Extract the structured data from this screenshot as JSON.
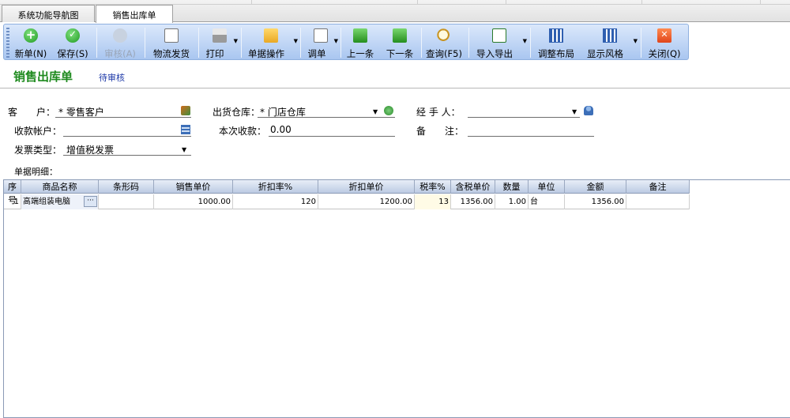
{
  "tabs": [
    {
      "label": "系统功能导航图"
    },
    {
      "label": "销售出库单"
    }
  ],
  "toolbar": {
    "buttons": [
      {
        "label": "新单(N)",
        "icon": "plus-circle-icon"
      },
      {
        "label": "保存(S)",
        "icon": "check-circle-icon"
      },
      {
        "label": "审核(A)",
        "icon": "audit-icon"
      },
      {
        "label": "物流发货",
        "icon": "logistics-icon"
      },
      {
        "label": "打印",
        "icon": "printer-icon"
      },
      {
        "label": "单据操作",
        "icon": "folder-icon"
      },
      {
        "label": "调单",
        "icon": "document-icon"
      },
      {
        "label": "上一条",
        "icon": "prev-icon"
      },
      {
        "label": "下一条",
        "icon": "next-icon"
      },
      {
        "label": "查询(F5)",
        "icon": "search-icon"
      },
      {
        "label": "导入导出",
        "icon": "excel-icon"
      },
      {
        "label": "调整布局",
        "icon": "layout-icon"
      },
      {
        "label": "显示风格",
        "icon": "style-icon"
      },
      {
        "label": "关闭(Q)",
        "icon": "close-icon"
      }
    ]
  },
  "header": {
    "title": "销售出库单",
    "status": "待审核"
  },
  "form": {
    "customer": {
      "label": "客　　户：",
      "value": "* 零售客户"
    },
    "warehouse": {
      "label": "出货仓库：",
      "value": "* 门店仓库"
    },
    "handler": {
      "label": "经 手 人：",
      "value": ""
    },
    "account": {
      "label": "收款帐户：",
      "value": ""
    },
    "received": {
      "label": "本次收款：",
      "value": "0.00"
    },
    "remark": {
      "label": "备　　注：",
      "value": ""
    },
    "invoice": {
      "label": "发票类型：",
      "value": "增值税发票"
    },
    "details_label": "单据明细："
  },
  "table": {
    "columns": [
      "序号",
      "商品名称",
      "条形码",
      "销售单价",
      "折扣率%",
      "折扣单价",
      "税率%",
      "含税单价",
      "数量",
      "单位",
      "金额",
      "备注"
    ],
    "rows": [
      {
        "no": "1",
        "name": "高端组装电脑",
        "barcode": "",
        "price": "1000.00",
        "discount": "120",
        "disc_price": "1200.00",
        "tax": "13",
        "tax_price": "1356.00",
        "qty": "1.00",
        "unit": "台",
        "amount": "1356.00",
        "note": ""
      }
    ]
  },
  "colors": {
    "title_green": "#1e8a1e",
    "status_blue": "#1e3aa8",
    "toolbar_blue": "#a9c6f0"
  }
}
